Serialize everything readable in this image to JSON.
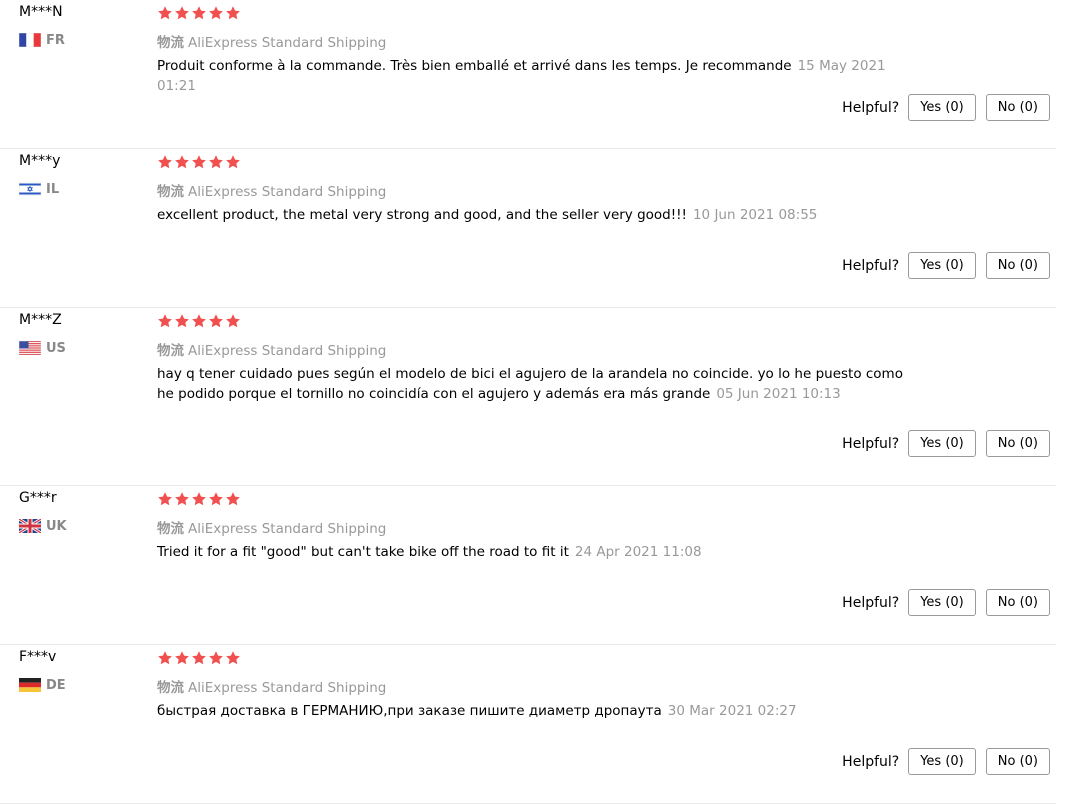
{
  "colors": {
    "star": "#f05050",
    "muted": "#999999",
    "divider": "#e8e8e8"
  },
  "reviews": [
    {
      "user": "M***N",
      "flag": "FR",
      "country": "FR",
      "rating": 5,
      "shipping_logo": "物流",
      "shipping": "AliExpress Standard Shipping",
      "text": "Produit conforme à la commande. Très bien emballé et arrivé dans les temps. Je recommande",
      "date": "15 May 2021 01:21",
      "helpful_label": "Helpful?",
      "yes_label": "Yes (0)",
      "no_label": "No (0)"
    },
    {
      "user": "M***y",
      "flag": "IL",
      "country": "IL",
      "rating": 5,
      "shipping_logo": "物流",
      "shipping": "AliExpress Standard Shipping",
      "text": "excellent product, the metal very strong and good, and the seller very good!!!",
      "date": "10 Jun 2021 08:55",
      "helpful_label": "Helpful?",
      "yes_label": "Yes (0)",
      "no_label": "No (0)"
    },
    {
      "user": "M***Z",
      "flag": "US",
      "country": "US",
      "rating": 5,
      "shipping_logo": "物流",
      "shipping": "AliExpress Standard Shipping",
      "text": "hay q tener cuidado pues según el modelo de bici el agujero de la arandela no coincide. yo lo he puesto como he podido porque el tornillo no coincidía con el agujero y además era más grande",
      "date": "05 Jun 2021 10:13",
      "helpful_label": "Helpful?",
      "yes_label": "Yes (0)",
      "no_label": "No (0)"
    },
    {
      "user": "G***r",
      "flag": "UK",
      "country": "UK",
      "rating": 5,
      "shipping_logo": "物流",
      "shipping": "AliExpress Standard Shipping",
      "text": "Tried it for a fit \"good\" but can't take bike off the road to fit it",
      "date": "24 Apr 2021 11:08",
      "helpful_label": "Helpful?",
      "yes_label": "Yes (0)",
      "no_label": "No (0)"
    },
    {
      "user": "F***v",
      "flag": "DE",
      "country": "DE",
      "rating": 5,
      "shipping_logo": "物流",
      "shipping": "AliExpress Standard Shipping",
      "text": "быстрая доставка в ГЕРМАНИЮ,при заказе пишите диаметр дропаута",
      "date": "30 Mar 2021 02:27",
      "helpful_label": "Helpful?",
      "yes_label": "Yes (0)",
      "no_label": "No (0)"
    }
  ]
}
